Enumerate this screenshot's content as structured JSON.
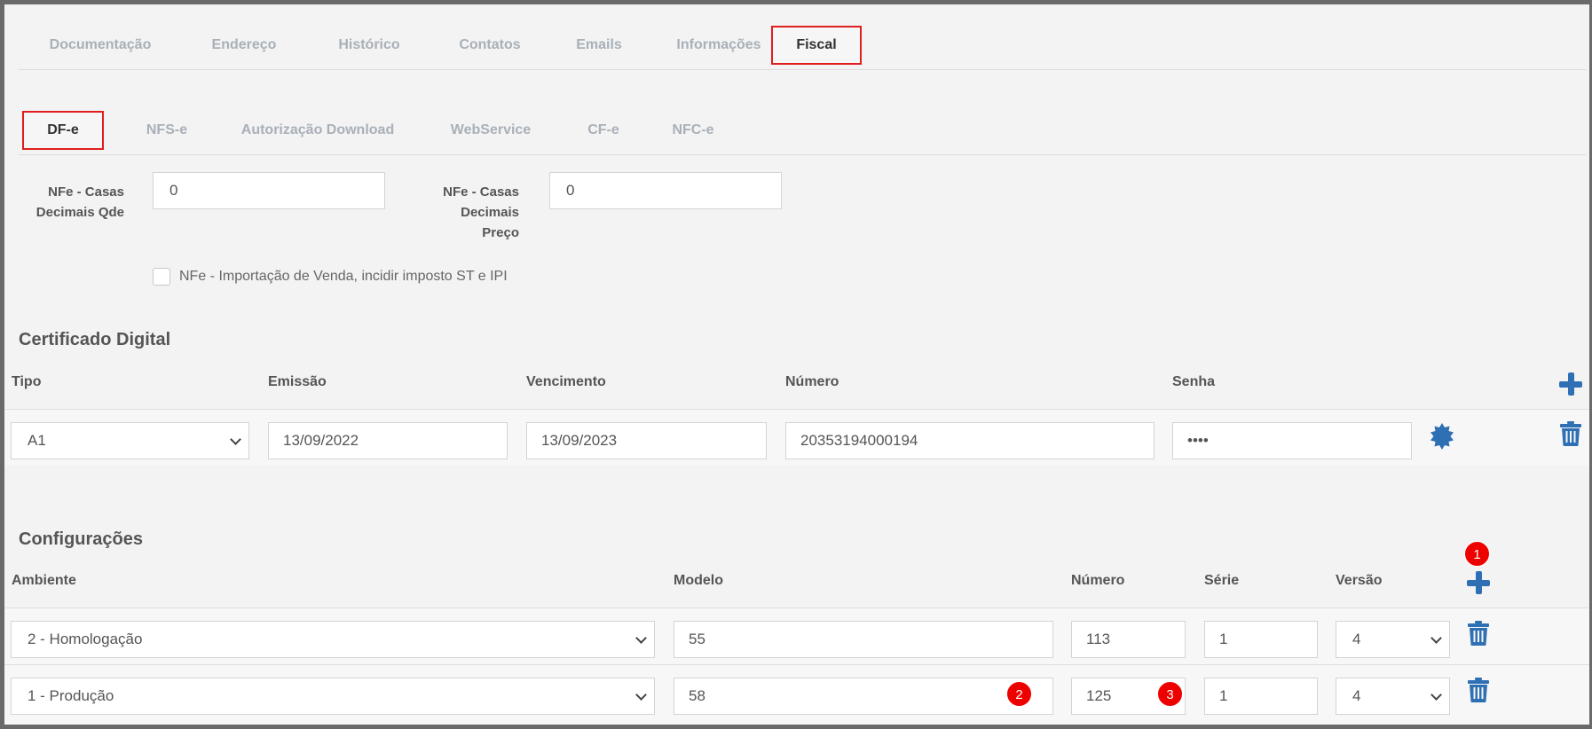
{
  "top_tabs": [
    {
      "label": "Documentação"
    },
    {
      "label": "Endereço"
    },
    {
      "label": "Histórico"
    },
    {
      "label": "Contatos"
    },
    {
      "label": "Emails"
    },
    {
      "label": "Informações"
    },
    {
      "label": "Fiscal",
      "active": true
    }
  ],
  "sub_tabs": [
    {
      "label": "DF-e",
      "active": true
    },
    {
      "label": "NFS-e"
    },
    {
      "label": "Autorização Download"
    },
    {
      "label": "WebService"
    },
    {
      "label": "CF-e"
    },
    {
      "label": "NFC-e"
    }
  ],
  "dfe": {
    "casas_qde_label_1": "NFe - Casas",
    "casas_qde_label_2": "Decimais Qde",
    "casas_qde_value": "0",
    "casas_preco_label_1": "NFe - Casas",
    "casas_preco_label_2": "Decimais",
    "casas_preco_label_3": "Preço",
    "casas_preco_value": "0",
    "importacao_label": "NFe - Importação de Venda, incidir imposto ST e IPI",
    "importacao_checked": false
  },
  "certificado": {
    "title": "Certificado Digital",
    "headers": {
      "tipo": "Tipo",
      "emissao": "Emissão",
      "vencimento": "Vencimento",
      "numero": "Número",
      "senha": "Senha"
    },
    "row": {
      "tipo": "A1",
      "emissao": "13/09/2022",
      "vencimento": "13/09/2023",
      "numero": "20353194000194",
      "senha": "••••"
    }
  },
  "configuracoes": {
    "title": "Configurações",
    "headers": {
      "ambiente": "Ambiente",
      "modelo": "Modelo",
      "numero": "Número",
      "serie": "Série",
      "versao": "Versão"
    },
    "rows": [
      {
        "ambiente": "2 - Homologação",
        "modelo": "55",
        "numero": "113",
        "serie": "1",
        "versao": "4"
      },
      {
        "ambiente": "1 - Produção",
        "modelo": "58",
        "numero": "125",
        "serie": "1",
        "versao": "4"
      }
    ]
  },
  "badges": [
    "1",
    "2",
    "3"
  ],
  "colors": {
    "accent_blue": "#2f6fb3",
    "highlight_red": "#e01e1e",
    "badge_red": "#ee0000"
  },
  "icons": {
    "add": "plus-icon",
    "delete": "trash-icon",
    "certificate": "gear-icon"
  }
}
